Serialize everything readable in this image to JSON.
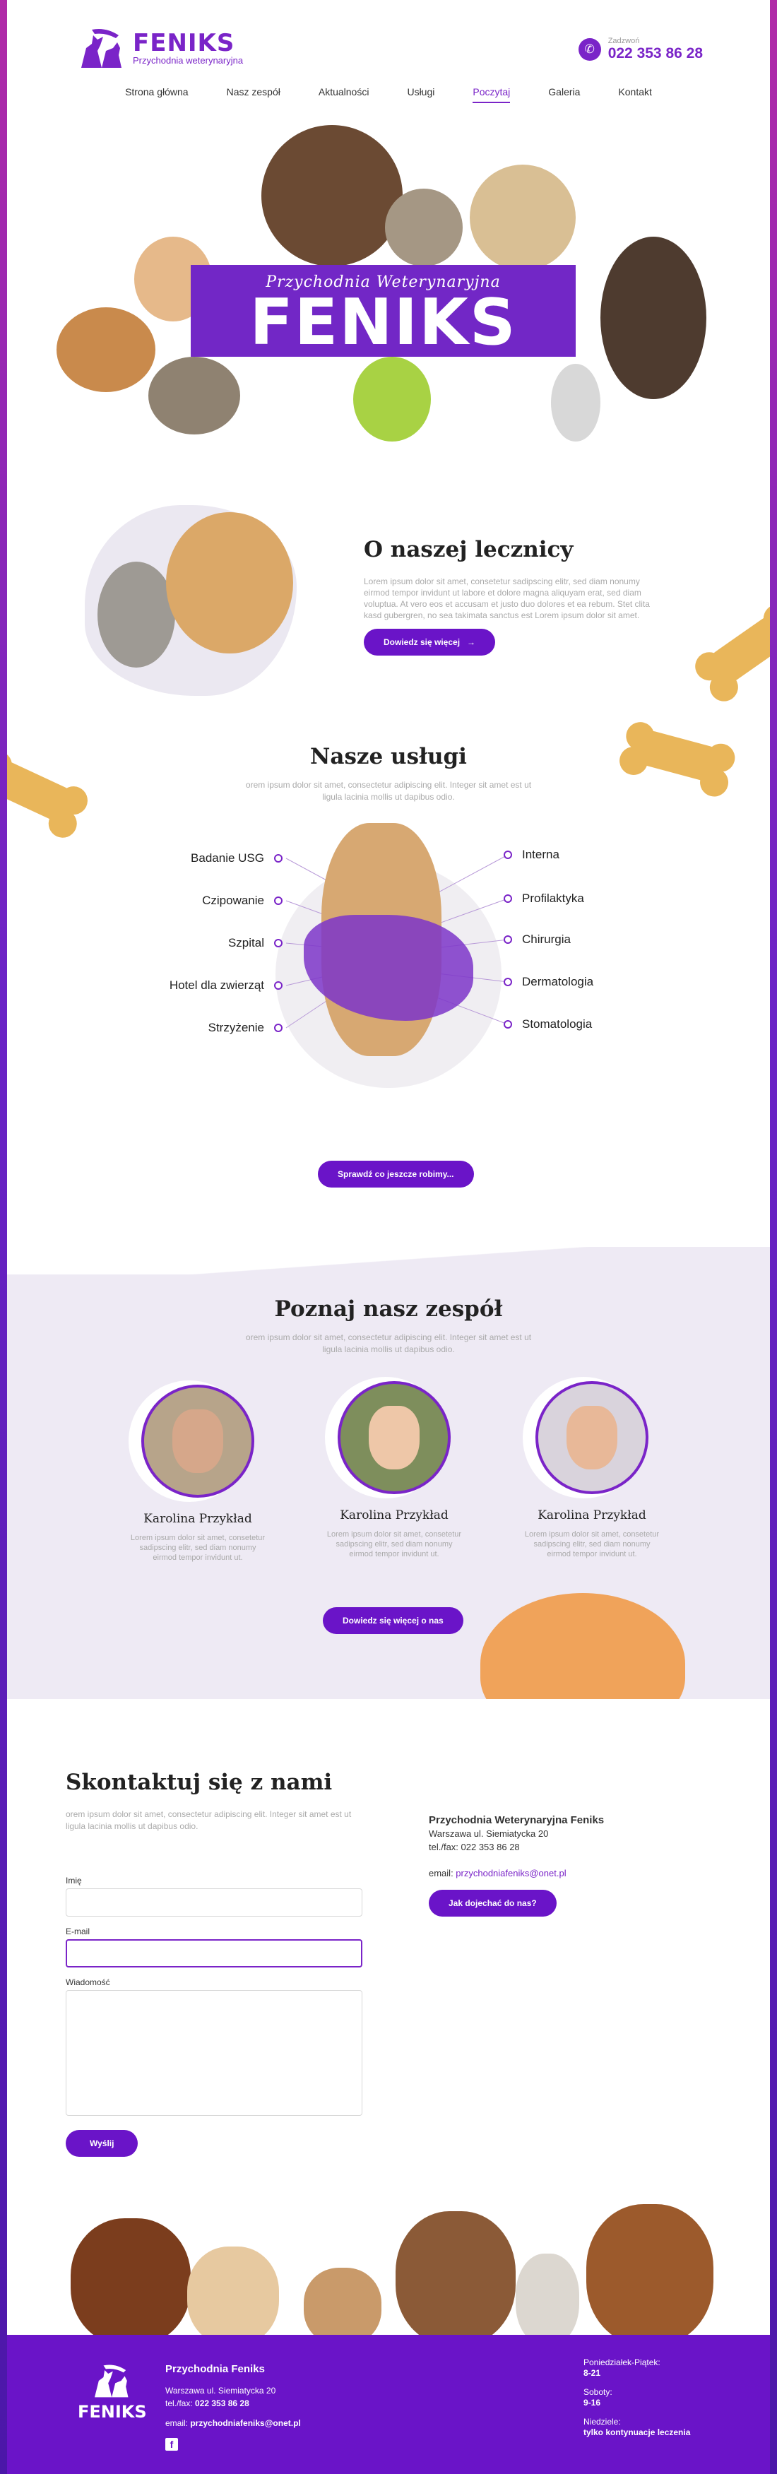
{
  "header": {
    "brand": "FENIKS",
    "brand_sub": "Przychodnia weterynaryjna",
    "phone_label": "Zadzwoń",
    "phone": "022 353 86 28",
    "nav": [
      "Strona główna",
      "Nasz zespół",
      "Aktualności",
      "Usługi",
      "Poczytaj",
      "Galeria",
      "Kontakt"
    ],
    "active_nav": "Poczytaj"
  },
  "hero": {
    "script": "Przychodnia Weterynaryjna",
    "title": "FENIKS"
  },
  "about": {
    "title": "O naszej lecznicy",
    "text": "Lorem ipsum dolor sit amet, consetetur sadipscing elitr, sed diam nonumy eirmod tempor invidunt ut labore et dolore magna aliquyam erat, sed diam voluptua. At vero eos et accusam et justo duo dolores et ea rebum. Stet clita kasd gubergren, no sea takimata sanctus est Lorem ipsum dolor sit amet.",
    "button": "Dowiedz się więcej"
  },
  "services": {
    "title": "Nasze usługi",
    "subtitle": "orem ipsum dolor sit amet, consectetur adipiscing elit. Integer sit amet est ut ligula lacinia mollis ut dapibus odio.",
    "left": [
      "Badanie USG",
      "Czipowanie",
      "Szpital",
      "Hotel dla zwierząt",
      "Strzyżenie"
    ],
    "right": [
      "Interna",
      "Profilaktyka",
      "Chirurgia",
      "Dermatologia",
      "Stomatologia"
    ],
    "button": "Sprawdź co jeszcze robimy..."
  },
  "team": {
    "title": "Poznaj nasz zespół",
    "subtitle": "orem ipsum dolor sit amet, consectetur adipiscing elit. Integer sit amet est ut ligula lacinia mollis ut dapibus odio.",
    "members": [
      {
        "name": "Karolina Przykład",
        "bio": "Lorem ipsum dolor sit amet, consetetur sadipscing elitr, sed diam nonumy eirmod tempor invidunt ut."
      },
      {
        "name": "Karolina Przykład",
        "bio": "Lorem ipsum dolor sit amet, consetetur sadipscing elitr, sed diam nonumy eirmod tempor invidunt ut."
      },
      {
        "name": "Karolina Przykład",
        "bio": "Lorem ipsum dolor sit amet, consetetur sadipscing elitr, sed diam nonumy eirmod tempor invidunt ut."
      }
    ],
    "button": "Dowiedz się więcej o nas"
  },
  "contact": {
    "title": "Skontaktuj się z nami",
    "subtitle": "orem ipsum dolor sit amet, consectetur adipiscing elit. Integer sit amet est ut ligula lacinia mollis ut dapibus odio.",
    "name_label": "Imię",
    "email_label": "E-mail",
    "message_label": "Wiadomość",
    "send": "Wyślij",
    "clinic_name": "Przychodnia Weterynaryjna Feniks",
    "address": "Warszawa ul. Siemiatycka 20",
    "phone": "tel./fax: 022 353 86 28",
    "email_prefix": "email: ",
    "email": "przychodniafeniks@onet.pl",
    "directions": "Jak dojechać do nas?"
  },
  "footer": {
    "brand": "FENIKS",
    "title": "Przychodnia Feniks",
    "address": "Warszawa ul. Siemiatycka 20",
    "phone_prefix": "tel./fax: ",
    "phone": "022 353 86 28",
    "email_prefix": "email: ",
    "email": "przychodniafeniks@onet.pl",
    "hours": [
      {
        "label": "Poniedziałek-Piątek:",
        "value": "8-21"
      },
      {
        "label": "Soboty:",
        "value": "9-16"
      },
      {
        "label": "Niedziele:",
        "value": "tylko kontynuacje leczenia"
      }
    ]
  },
  "colors": {
    "accent": "#6a14c8",
    "bone": "#e9b65a",
    "team_bg": "#eeeaf4"
  }
}
